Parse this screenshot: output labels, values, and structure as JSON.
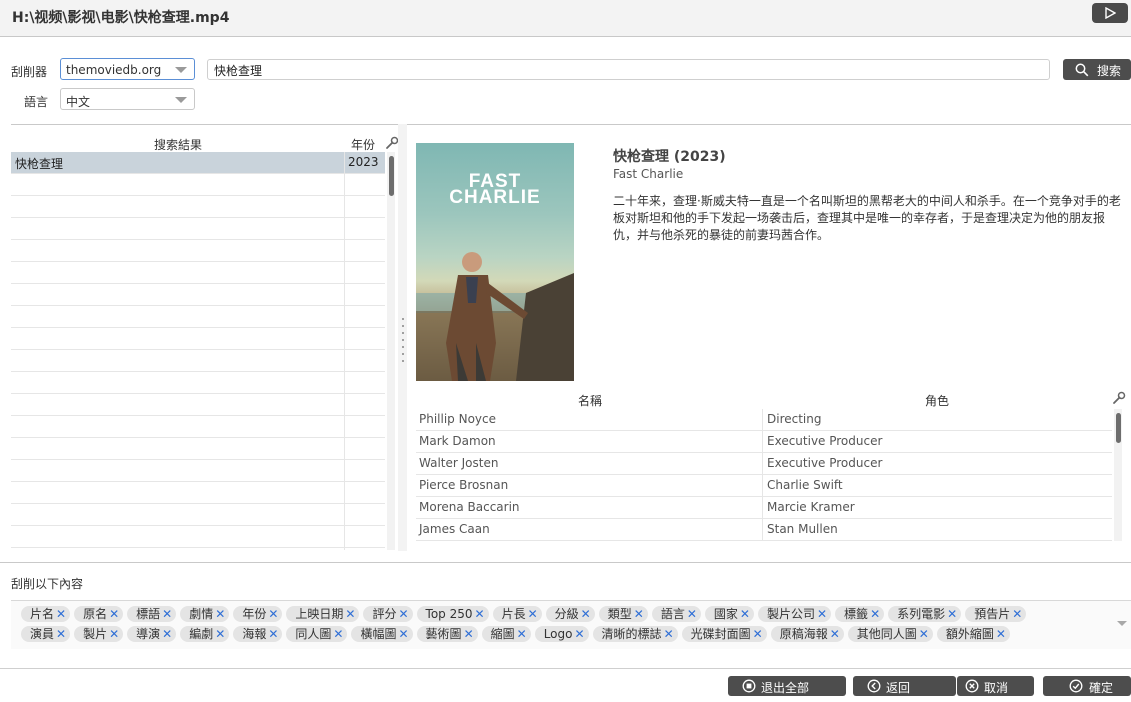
{
  "window": {
    "title": "H:\\视频\\影视\\电影\\快枪查理.mp4"
  },
  "form": {
    "scraper_label": "刮削器",
    "scraper_value": "themoviedb.org",
    "language_label": "語言",
    "language_value": "中文",
    "query": "快枪查理",
    "search_label": "搜索"
  },
  "results": {
    "col_title": "搜索結果",
    "col_year": "年份",
    "rows": [
      {
        "title": "快枪查理",
        "year": "2023"
      }
    ]
  },
  "movie": {
    "title": "快枪查理 (2023)",
    "original_title": "Fast Charlie",
    "plot": "二十年来，查理·斯威夫特一直是一个名叫斯坦的黑帮老大的中间人和杀手。在一个竞争对手的老板对斯坦和他的手下发起一场袭击后，查理其中是唯一的幸存者，于是查理决定为他的朋友报仇，并与他杀死的暴徒的前妻玛茜合作。",
    "poster_text_line1": "FAST",
    "poster_text_line2": "CHARLIE"
  },
  "cast": {
    "col_name": "名稱",
    "col_role": "角色",
    "rows": [
      {
        "name": "Phillip Noyce",
        "role": "Directing"
      },
      {
        "name": "Mark Damon",
        "role": "Executive Producer"
      },
      {
        "name": "Walter Josten",
        "role": "Executive Producer"
      },
      {
        "name": "Pierce Brosnan",
        "role": "Charlie Swift"
      },
      {
        "name": "Morena Baccarin",
        "role": "Marcie Kramer"
      },
      {
        "name": "James Caan",
        "role": "Stan Mullen"
      }
    ]
  },
  "scrape_items": {
    "label": "刮削以下內容",
    "row1": [
      "片名",
      "原名",
      "標語",
      "劇情",
      "年份",
      "上映日期",
      "評分",
      "Top 250",
      "片長",
      "分級",
      "類型",
      "語言",
      "國家",
      "製片公司",
      "標籤",
      "系列電影",
      "預告片"
    ],
    "row2": [
      "演員",
      "製片",
      "導演",
      "編劇",
      "海報",
      "同人圖",
      "橫幅圖",
      "藝術圖",
      "縮圖",
      "Logo",
      "清晰的標誌",
      "光碟封面圖",
      "原稿海報",
      "其他同人圖",
      "額外縮圖"
    ]
  },
  "buttons": {
    "exit_all": "退出全部",
    "back": "返回",
    "cancel": "取消",
    "ok": "確定"
  },
  "colors": {
    "button_bg": "#4d4d4d",
    "selected_row": "#c9d3db",
    "remove_x": "#2f6fd6"
  }
}
